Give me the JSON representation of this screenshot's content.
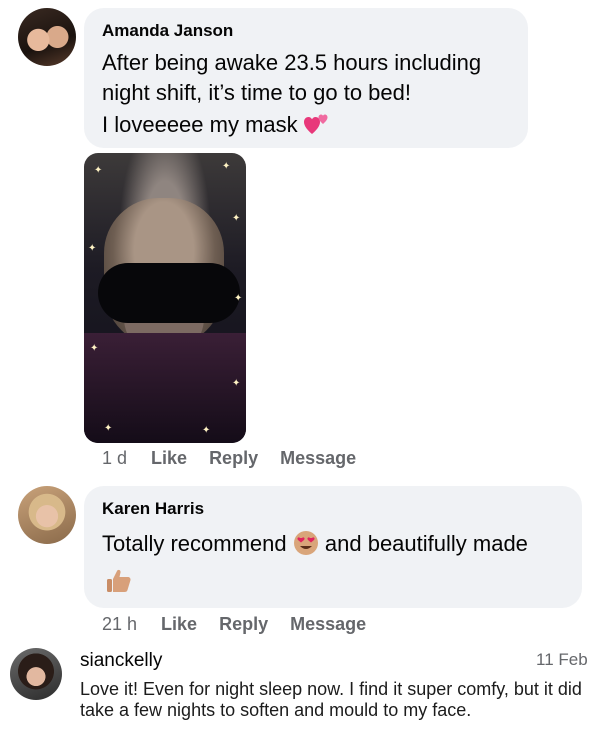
{
  "comments": [
    {
      "author": "Amanda Janson",
      "lines": [
        "After being awake 23.5 hours including",
        "night shift, it’s time to go to bed!"
      ],
      "line3": "I loveeeee my mask",
      "emoji": "two-hearts",
      "time": "1 d",
      "like": "Like",
      "reply": "Reply",
      "message": "Message"
    },
    {
      "author": "Karen Harris",
      "text_before": "Totally recommend",
      "text_after": "and beautifully made",
      "emoji": "heart-eyes",
      "time": "21 h",
      "like": "Like",
      "reply": "Reply",
      "message": "Message"
    }
  ],
  "instagram_comment": {
    "username": "sianckelly",
    "date": "11 Feb",
    "text": "Love it! Even for night sleep now. I find it super comfy, but it did take a few nights to soften and mould to my face."
  },
  "colors": {
    "bubble": "#f0f2f5",
    "secondary_text": "#65676b"
  }
}
